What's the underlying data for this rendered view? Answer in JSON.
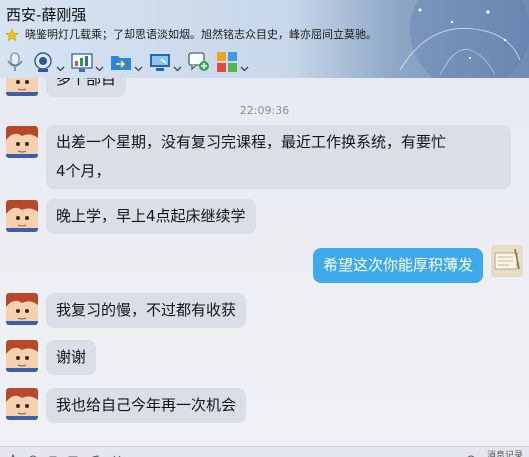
{
  "window": {
    "title": "西安-薛刚强",
    "signature": "晓鉴明灯几载乘；了却思语淡如烟。旭然铭志众目史，峰亦屈间立莫驰。"
  },
  "toolbar": {
    "items": [
      {
        "icon": "microphone-icon"
      },
      {
        "icon": "webcam-icon"
      },
      {
        "icon": "screen-share-icon"
      },
      {
        "icon": "file-transfer-icon"
      },
      {
        "icon": "remote-desktop-icon"
      },
      {
        "icon": "add-chat-icon"
      },
      {
        "icon": "apps-icon"
      }
    ]
  },
  "chat": {
    "partial_message": "多个部目",
    "timestamp": "22:09:36",
    "messages": [
      {
        "from": "contact",
        "lines": [
          "出差一个星期，没有复习完课程，最近工作换系统，有要忙",
          "4个月，"
        ]
      },
      {
        "from": "contact",
        "lines": [
          "晚上学，早上4点起床继续学"
        ]
      },
      {
        "from": "me",
        "lines": [
          "希望这次你能厚积薄发"
        ]
      },
      {
        "from": "contact",
        "lines": [
          "我复习的慢，不过都有收获"
        ]
      },
      {
        "from": "contact",
        "lines": [
          "谢谢"
        ]
      },
      {
        "from": "contact",
        "lines": [
          "我也给自己今年再一次机会"
        ]
      }
    ]
  },
  "bottom": {
    "history_label": "消息记录"
  },
  "colors": {
    "outgoing_bubble": "#3fa9ee",
    "incoming_bubble": "#d9dee7"
  }
}
